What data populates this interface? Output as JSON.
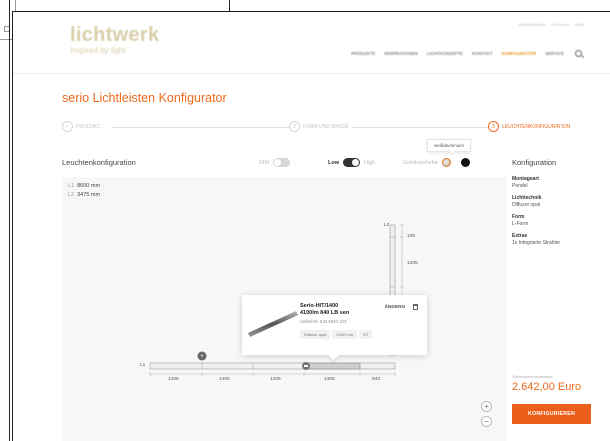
{
  "header": {
    "logo_main": "lichtwerk",
    "logo_sub": "inspired by light",
    "util_links": [
      "Ändertestkonto",
      "ll-Account",
      "de/at"
    ],
    "nav": [
      "PRODUKTE",
      "INSPIRATIONEN",
      "LICHTKONZEPTE",
      "KONTAKT",
      "KONFIGURATOR",
      "SERVICE"
    ],
    "nav_active_index": 4
  },
  "page_title": "serio Lichtleisten Konfigurator",
  "steps": [
    {
      "number": "✓",
      "label": "PRODUKT",
      "state": "done"
    },
    {
      "number": "2",
      "label": "FORM UND MASSE",
      "state": "done"
    },
    {
      "number": "3",
      "label": "LEUCHTENKONFIGURATION",
      "state": "active"
    }
  ],
  "toolbar": {
    "section_label": "Leuchtenkonfiguration",
    "dim_label": "DIM",
    "low_label": "Low",
    "high_label": "High",
    "housing_label": "Gehäusefarbe",
    "tooltip": "weißaluminium"
  },
  "canvas": {
    "l1_label": "L1",
    "l1_value": "8600 mm",
    "l2_label": "L2",
    "l2_value": "3475 mm",
    "horizontal_segments": [
      "1405",
      "1405",
      "1405",
      "1405",
      "843"
    ],
    "vertical_top": "106",
    "vertical_segment": "1405",
    "label_l1": "L1",
    "label_l2": "L2",
    "zoom_in": "+",
    "zoom_out": "−"
  },
  "popup": {
    "title_line1": "Serio-HIT/1400",
    "title_line2": "4100lm 840 LB sen",
    "article": "Artikel-Nr. 543 5044 103",
    "tags": [
      "Diffusor opal",
      "1400 mm",
      "DT"
    ],
    "change": "ÄNDERN"
  },
  "sidebar": {
    "title": "Konfiguration",
    "items": [
      {
        "key": "Montageart",
        "value": "Pendel"
      },
      {
        "key": "Lichttechnik",
        "value": "Diffusor opal"
      },
      {
        "key": "Form",
        "value": "L-Form"
      },
      {
        "key": "Extras",
        "value": "1x Integrierte Strahler"
      }
    ],
    "price_label": "Systempreis/Installation*",
    "price": "2.642,00 Euro",
    "cta": "KONFIGURIEREN"
  },
  "colors": {
    "accent": "#ec6a1c",
    "cta": "#ec5e1c",
    "canvas_bg": "#f7f7f7"
  }
}
